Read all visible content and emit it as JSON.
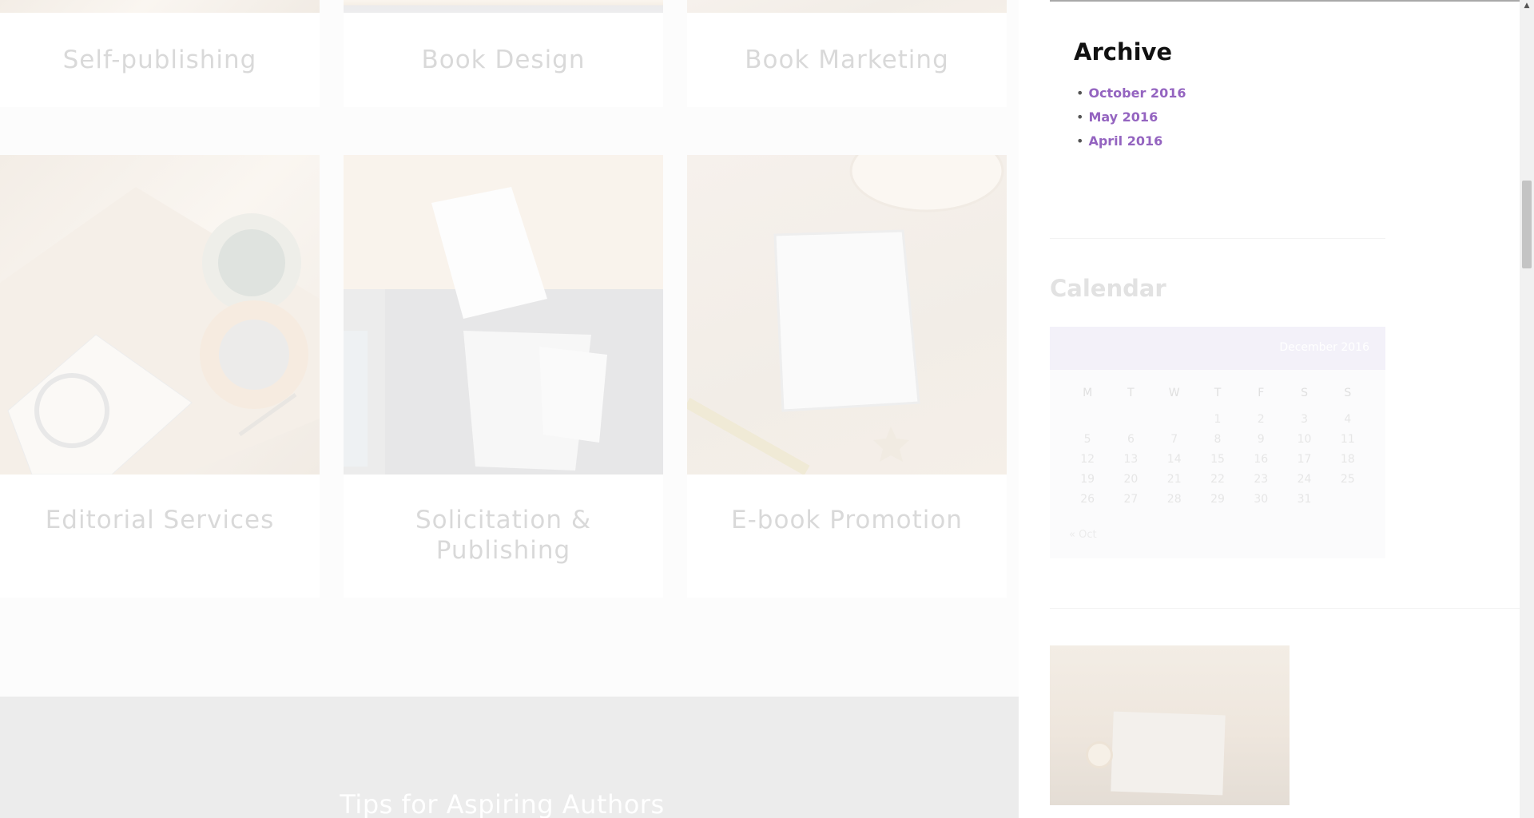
{
  "services": [
    {
      "title": "Self-publishing",
      "photo": "desk-photo"
    },
    {
      "title": "Book Design",
      "photo": "desk-photo"
    },
    {
      "title": "Book Marketing",
      "photo": "desk-photo"
    },
    {
      "title": "Editorial Services",
      "photo": "plant-notebook-coffee-photo"
    },
    {
      "title": "Solicitation & Publishing",
      "photo": "signing-documents-photo"
    },
    {
      "title": "E-book Promotion",
      "photo": "tablet-on-sand-photo"
    }
  ],
  "tips": {
    "title": "Tips for Aspiring Authors"
  },
  "sidebar": {
    "archive": {
      "title": "Archive",
      "items": [
        "October 2016",
        "May 2016",
        "April 2016"
      ]
    },
    "calendar": {
      "title": "Calendar",
      "month": "December 2016",
      "weekdays": [
        "M",
        "T",
        "W",
        "T",
        "F",
        "S",
        "S"
      ],
      "weeks": [
        [
          "",
          "",
          "",
          "1",
          "2",
          "3",
          "4"
        ],
        [
          "5",
          "6",
          "7",
          "8",
          "9",
          "10",
          "11"
        ],
        [
          "12",
          "13",
          "14",
          "15",
          "16",
          "17",
          "18"
        ],
        [
          "19",
          "20",
          "21",
          "22",
          "23",
          "24",
          "25"
        ],
        [
          "26",
          "27",
          "28",
          "29",
          "30",
          "31",
          ""
        ]
      ],
      "prev_link": "« Oct"
    }
  },
  "colors": {
    "archive_link": "#9464c0",
    "calendar_header": "#f3f1f9"
  }
}
